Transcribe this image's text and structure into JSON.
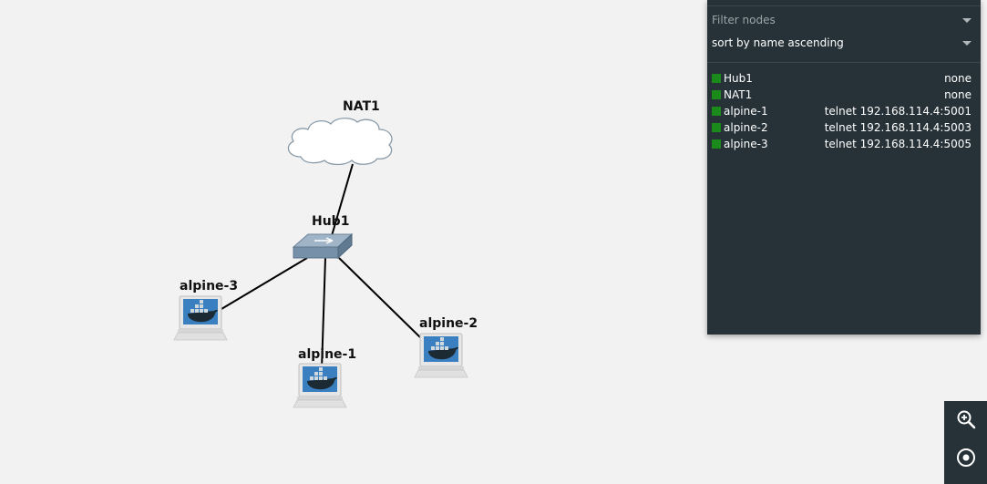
{
  "topology": {
    "nodes": [
      {
        "id": "nat1",
        "label": "NAT1",
        "kind": "cloud"
      },
      {
        "id": "hub1",
        "label": "Hub1",
        "kind": "hub"
      },
      {
        "id": "alpine3",
        "label": "alpine-3",
        "kind": "docker-host"
      },
      {
        "id": "alpine1",
        "label": "alpine-1",
        "kind": "docker-host"
      },
      {
        "id": "alpine2",
        "label": "alpine-2",
        "kind": "docker-host"
      }
    ],
    "links": [
      [
        "nat1",
        "hub1"
      ],
      [
        "hub1",
        "alpine3"
      ],
      [
        "hub1",
        "alpine1"
      ],
      [
        "hub1",
        "alpine2"
      ]
    ]
  },
  "panel": {
    "filter_placeholder": "Filter nodes",
    "sort_value": "sort by name ascending",
    "status_color": "#1a8a1a",
    "nodes": [
      {
        "name": "Hub1",
        "console": "none"
      },
      {
        "name": "NAT1",
        "console": "none"
      },
      {
        "name": "alpine-1",
        "console": "telnet 192.168.114.4:5001"
      },
      {
        "name": "alpine-2",
        "console": "telnet 192.168.114.4:5003"
      },
      {
        "name": "alpine-3",
        "console": "telnet 192.168.114.4:5005"
      }
    ]
  },
  "toolbar": {
    "zoom_in_icon": "zoom-in-icon",
    "center_icon": "center-focus-icon"
  }
}
